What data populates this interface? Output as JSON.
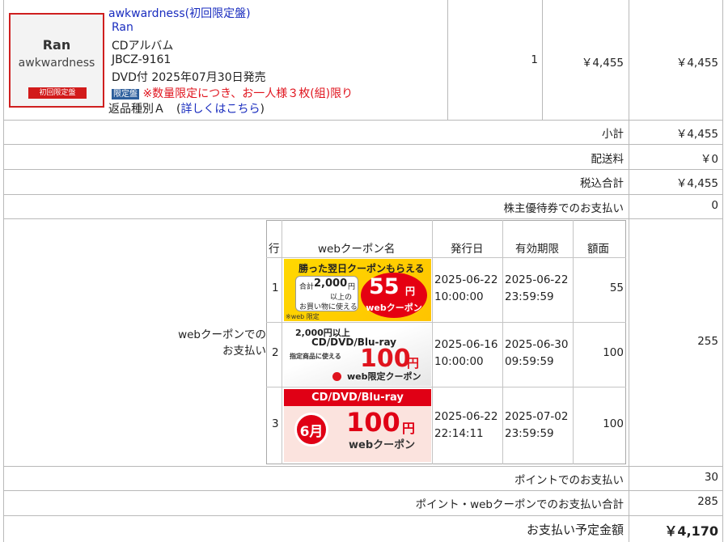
{
  "product": {
    "image": {
      "title": "Ran",
      "artist": "awkwardness",
      "tag": "初回限定盤"
    },
    "name_link": "awkwardness(初回限定盤)",
    "title_link": "Ran",
    "format": "CDアルバム",
    "catalog_no": "JBCZ-9161",
    "release": "DVD付 2025年07月30日発売",
    "limited_badge": "限定盤",
    "limit_note": "※数量限定につき、お一人様３枚(組)限り",
    "return_type": "返品種別Ａ　(",
    "return_link": "詳しくはこちら",
    "return_close": ")",
    "quantity": "1",
    "unit_price": "￥4,455",
    "line_total": "￥4,455"
  },
  "summary": {
    "subtotal_label": "小計",
    "subtotal": "￥4,455",
    "shipping_label": "配送料",
    "shipping": "￥0",
    "tax_total_label": "税込合計",
    "tax_total": "￥4,455",
    "shareholder_label": "株主優待券でのお支払い",
    "shareholder": "0",
    "coupon_pay_label_1": "webクーポンでの",
    "coupon_pay_label_2": "お支払い",
    "coupon_pay_total": "255",
    "point_label": "ポイントでのお支払い",
    "point": "30",
    "point_coupon_label": "ポイント・webクーポンでのお支払い合計",
    "point_coupon": "285",
    "due_label": "お支払い予定金額",
    "due": "￥4,170"
  },
  "coupons": {
    "headers": {
      "row": "行",
      "name": "webクーポン名",
      "issued": "発行日",
      "expires": "有効期限",
      "amount": "額面"
    },
    "rows": [
      {
        "row": "1",
        "issued_date": "2025-06-22",
        "issued_time": "10:00:00",
        "expires_date": "2025-06-22",
        "expires_time": "23:59:59",
        "amount": "55",
        "banner": {
          "top": "勝った翌日クーポンもらえる",
          "box_1": "合計",
          "box_amount": "2,000",
          "box_yen": "円",
          "box_2": "以上の",
          "box_3": "お買い物に使える",
          "value": "55",
          "yen": "円",
          "label": "webクーポン",
          "foot": "※web 限定"
        }
      },
      {
        "row": "2",
        "issued_date": "2025-06-16",
        "issued_time": "10:00:00",
        "expires_date": "2025-06-30",
        "expires_time": "09:59:59",
        "amount": "100",
        "banner": {
          "line1": "2,000円以上",
          "line2": "CD/DVD/Blu-ray",
          "line3": "指定商品に使える",
          "value": "100",
          "yen": "円",
          "label": "web限定クーポン"
        }
      },
      {
        "row": "3",
        "issued_date": "2025-06-22",
        "issued_time": "22:14:11",
        "expires_date": "2025-07-02",
        "expires_time": "23:59:59",
        "amount": "100",
        "banner": {
          "header": "CD/DVD/Blu-ray",
          "month": "6月",
          "value": "100",
          "yen": "円",
          "label": "webクーポン"
        }
      }
    ]
  },
  "colors": {
    "link": "#1a2dbf",
    "alert": "#e0141e",
    "badge": "#2c5e9c",
    "border": "#b9b9b9"
  }
}
